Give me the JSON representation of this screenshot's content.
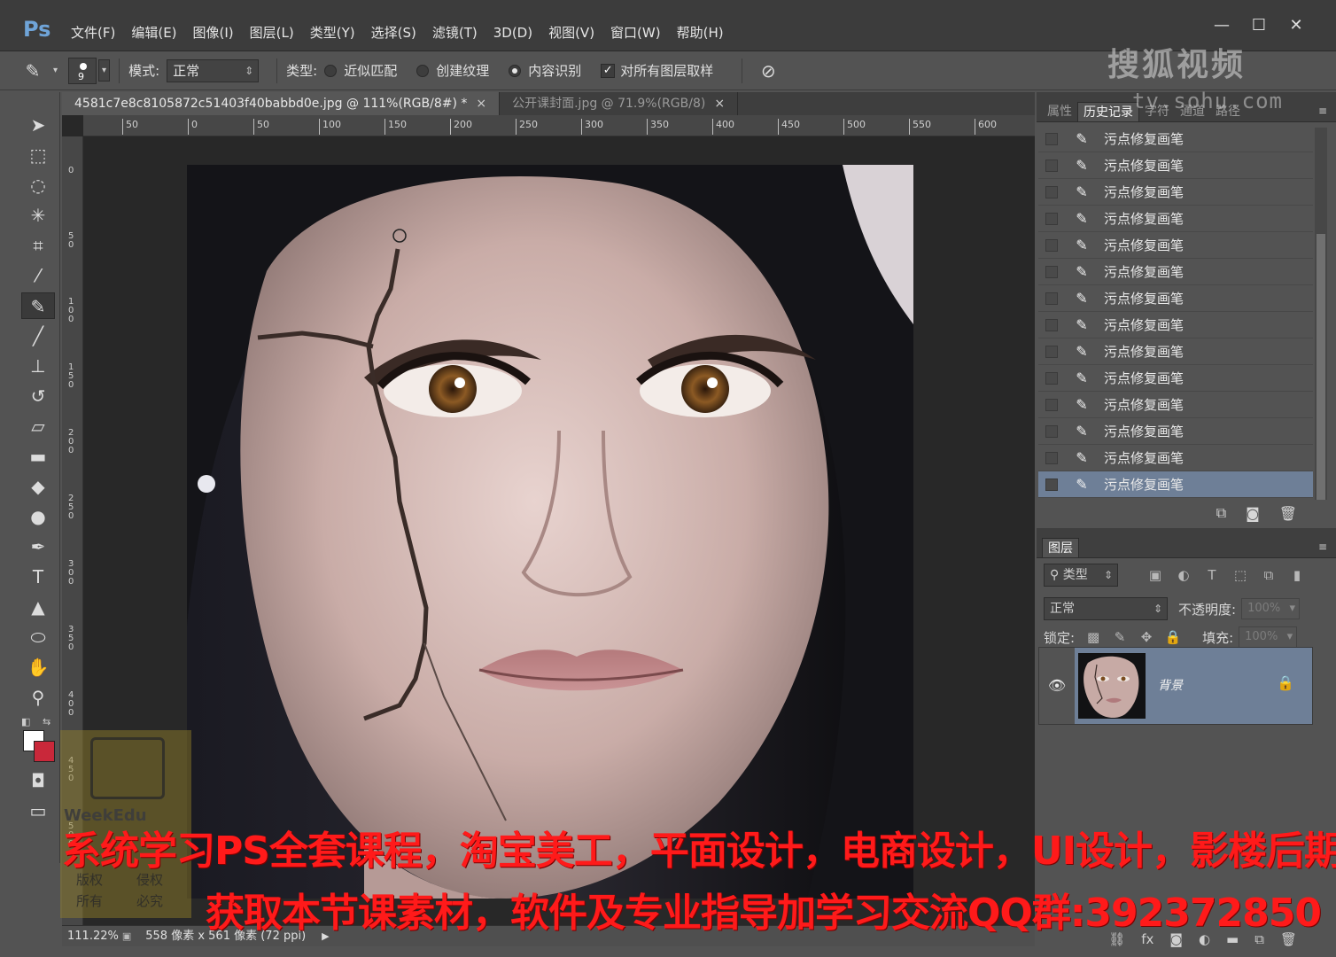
{
  "app": {
    "logo": "Ps",
    "menu": [
      "文件(F)",
      "编辑(E)",
      "图像(I)",
      "图层(L)",
      "类型(Y)",
      "选择(S)",
      "滤镜(T)",
      "3D(D)",
      "视图(V)",
      "窗口(W)",
      "帮助(H)"
    ],
    "window_buttons": [
      "—",
      "☐",
      "✕"
    ]
  },
  "watermark": {
    "brand": "搜狐视频",
    "url": "tv.sohu.com"
  },
  "options_bar": {
    "brush_size": "9",
    "mode_label": "模式:",
    "mode_value": "正常",
    "type_label": "类型:",
    "type_options": [
      "近似匹配",
      "创建纹理",
      "内容识别"
    ],
    "type_selected_index": 2,
    "sample_all_label": "对所有图层取样",
    "sample_all_checked": true
  },
  "documents": {
    "tabs": [
      {
        "label": "4581c7e8c8105872c51403f40babbd0e.jpg @ 111%(RGB/8#) *",
        "active": true
      },
      {
        "label": "公开课封面.jpg @ 71.9%(RGB/8)",
        "active": false
      }
    ],
    "ruler_h": [
      "50",
      "0",
      "50",
      "100",
      "150",
      "200",
      "250",
      "300",
      "350",
      "400",
      "450",
      "500",
      "550",
      "600"
    ],
    "ruler_v": [
      "0",
      "50",
      "100",
      "150",
      "200",
      "250",
      "300",
      "350",
      "400",
      "450",
      "500"
    ]
  },
  "status": {
    "zoom": "111.22%",
    "info": "558 像素 x 561 像素 (72 ppi)"
  },
  "history_panel": {
    "tabs": [
      "属性",
      "历史记录",
      "字符",
      "通道",
      "路径"
    ],
    "active_tab": "历史记录",
    "item_label": "污点修复画笔",
    "items": [
      "污点修复画笔",
      "污点修复画笔",
      "污点修复画笔",
      "污点修复画笔",
      "污点修复画笔",
      "污点修复画笔",
      "污点修复画笔",
      "污点修复画笔",
      "污点修复画笔",
      "污点修复画笔",
      "污点修复画笔",
      "污点修复画笔",
      "污点修复画笔",
      "污点修复画笔"
    ]
  },
  "layers_panel": {
    "title": "图层",
    "filter_label": "类型",
    "blend_mode": "正常",
    "opacity_label": "不透明度:",
    "opacity_value": "100%",
    "lock_label": "锁定:",
    "fill_label": "填充:",
    "fill_value": "100%",
    "layer_name": "背景"
  },
  "promo": {
    "line1": "系统学习PS全套课程，淘宝美工，平面设计，电商设计，UI设计，影楼后期",
    "line2": "获取本节课素材，软件及专业指导加学习交流QQ群:392372850",
    "badge_brand": "WeekEdu",
    "badge_text": [
      "版权",
      "侵权",
      "所有",
      "必究"
    ]
  },
  "colors": {
    "accent": "#6e7f97",
    "promo_red": "#ff1a1a",
    "background_swatch": "#c9283a"
  }
}
